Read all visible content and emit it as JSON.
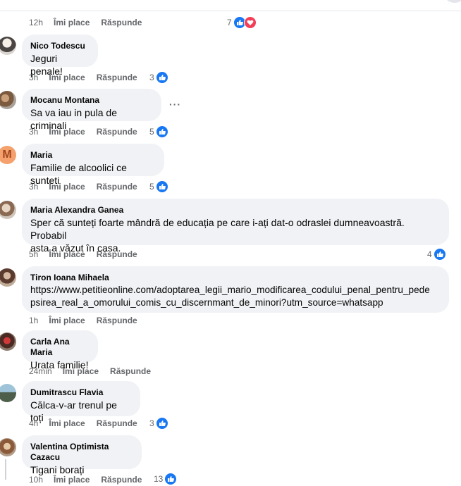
{
  "labels": {
    "like": "Îmi place",
    "reply": "Răspunde"
  },
  "colors": {
    "bubble": "#f0f2f5",
    "like_blue": "#1877f2",
    "love_red": "#f33e58",
    "meta_gray": "#65676b"
  },
  "top_row": {
    "time": "12h",
    "reactions": "7",
    "icons": [
      "like-icon",
      "love-icon"
    ]
  },
  "comments": [
    {
      "name": "Nico Todescu",
      "text": "Jeguri penale!",
      "time": "3h",
      "reactions": "3"
    },
    {
      "name": "Mocanu Montana",
      "text": "Sa va iau in pula de criminali",
      "time": "3h",
      "reactions": "5",
      "more": "···"
    },
    {
      "name": "Maria",
      "avatar_letter": "M",
      "text": "Familie de alcoolici ce sunteti",
      "time": "3h",
      "reactions": "5"
    },
    {
      "name": "Maria Alexandra Ganea",
      "text_line1": "Sper că sunteți foarte mândră de educația pe care i-ați dat-o odraslei dumneavoastră. Probabil",
      "text_line2": "asta a văzut în casa.",
      "time": "5h",
      "reactions": "4"
    },
    {
      "name": "Tiron Ioana Mihaela",
      "text_line1": "https://www.petitieonline.com/adoptarea_legii_mario_modificarea_codului_penal_pentru_pede",
      "text_line2": "psirea_real_a_omorului_comis_cu_discernmant_de_minori?utm_source=whatsapp",
      "time": "1h"
    },
    {
      "name": "Carla Ana Maria",
      "text": "Urata familie!",
      "time": "24min"
    },
    {
      "name": "Dumitrascu Flavia",
      "text": "Călca-v-ar trenul pe toți",
      "time": "4h",
      "reactions": "3"
    },
    {
      "name": "Valentina Optimista Cazacu",
      "text": "Tigani borați",
      "time": "10h",
      "reactions": "13"
    }
  ]
}
